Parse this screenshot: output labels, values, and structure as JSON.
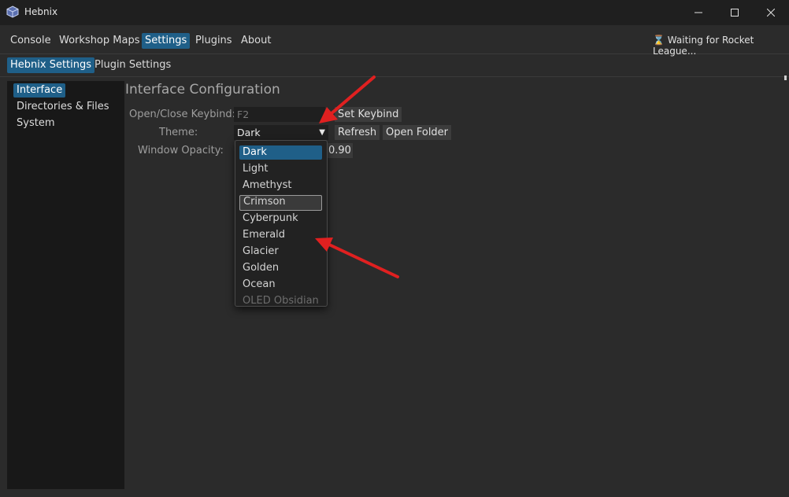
{
  "window": {
    "title": "Hebnix",
    "min_icon": "minimize-icon",
    "max_icon": "maximize-icon",
    "close_icon": "close-icon"
  },
  "menu": {
    "items": [
      "Console",
      "Workshop Maps",
      "Settings",
      "Plugins",
      "About"
    ],
    "active": "Settings"
  },
  "status": {
    "icon": "hourglass-icon",
    "text": "Waiting for Rocket League..."
  },
  "subtabs": {
    "items": [
      "Hebnix Settings",
      "Plugin Settings"
    ],
    "active": "Hebnix Settings"
  },
  "sidebar": {
    "items": [
      "Interface",
      "Directories & Files",
      "System"
    ],
    "active": "Interface"
  },
  "main": {
    "title": "Interface Configuration",
    "keybind": {
      "label": "Open/Close Keybind:",
      "value": "F2",
      "button": "Set Keybind"
    },
    "theme": {
      "label": "Theme:",
      "value": "Dark",
      "refresh": "Refresh",
      "open_folder": "Open Folder"
    },
    "opacity": {
      "label": "Window Opacity:",
      "value": "0.90"
    }
  },
  "theme_dropdown": {
    "options": [
      "Dark",
      "Light",
      "Amethyst",
      "Crimson",
      "Cyberpunk",
      "Emerald",
      "Glacier",
      "Golden",
      "Ocean",
      "OLED Obsidian"
    ],
    "selected": "Dark",
    "hovered": "Crimson"
  },
  "colors": {
    "accent": "#1f5f88",
    "annotation_arrow": "#e02020"
  }
}
